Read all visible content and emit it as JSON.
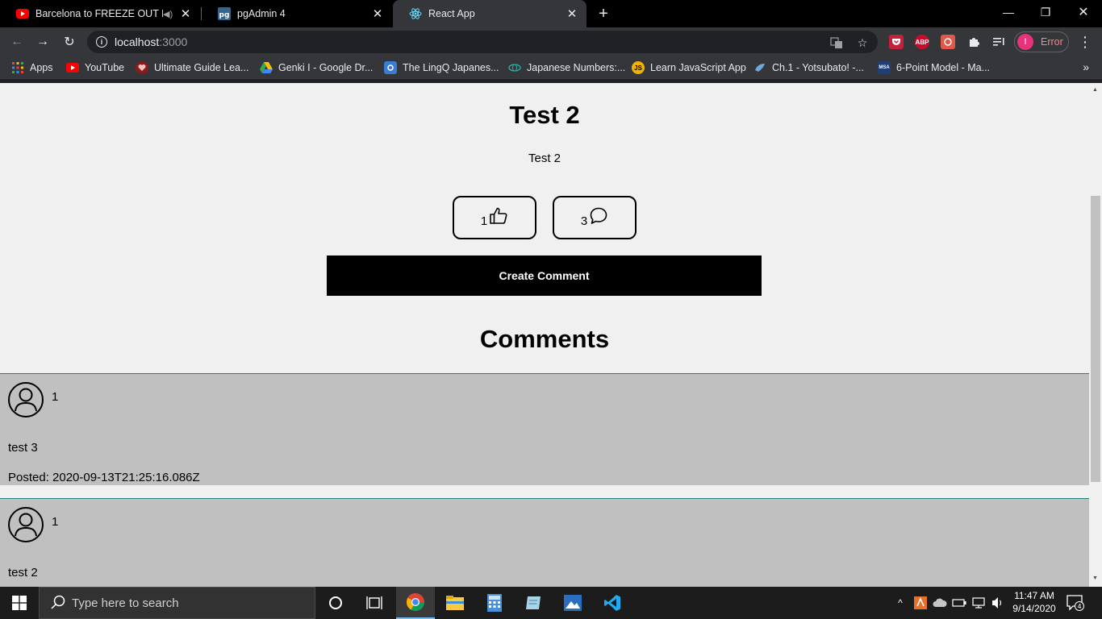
{
  "browser": {
    "tabs": [
      {
        "title": "Barcelona to FREEZE OUT Lu",
        "icon": "youtube-icon"
      },
      {
        "title": "pgAdmin 4",
        "icon": "pgadmin-icon"
      },
      {
        "title": "React App",
        "icon": "react-icon"
      }
    ],
    "url_host": "localhost",
    "url_port": ":3000",
    "profile_initial": "I",
    "profile_status": "Error",
    "extensions": [
      "ABP"
    ]
  },
  "bookmarks": [
    {
      "label": "Apps"
    },
    {
      "label": "YouTube"
    },
    {
      "label": "Ultimate Guide Lea..."
    },
    {
      "label": "Genki I - Google Dr..."
    },
    {
      "label": "The LingQ Japanes..."
    },
    {
      "label": "Japanese Numbers:..."
    },
    {
      "label": "Learn JavaScript App",
      "badge": "JS"
    },
    {
      "label": "Ch.1 - Yotsubato! -..."
    },
    {
      "label": "6-Point Model - Ma...",
      "badge": "MSA"
    }
  ],
  "post": {
    "title": "Test 2",
    "body": "Test 2",
    "likes": "1",
    "comments_count": "3",
    "create_comment_label": "Create Comment"
  },
  "comments_title": "Comments",
  "comments": [
    {
      "user": "1",
      "text": "test 3",
      "posted": "Posted: 2020-09-13T21:25:16.086Z"
    },
    {
      "user": "1",
      "text": "test 2",
      "posted": ""
    }
  ],
  "taskbar": {
    "search_placeholder": "Type here to search",
    "time": "11:47 AM",
    "date": "9/14/2020",
    "notification_count": "4"
  },
  "colors": {
    "accent_button": "#000000",
    "comment_bg": "#c0c0c0",
    "page_bg": "#f0f0f0",
    "error": "#f28b82",
    "profile": "#e8337c"
  }
}
